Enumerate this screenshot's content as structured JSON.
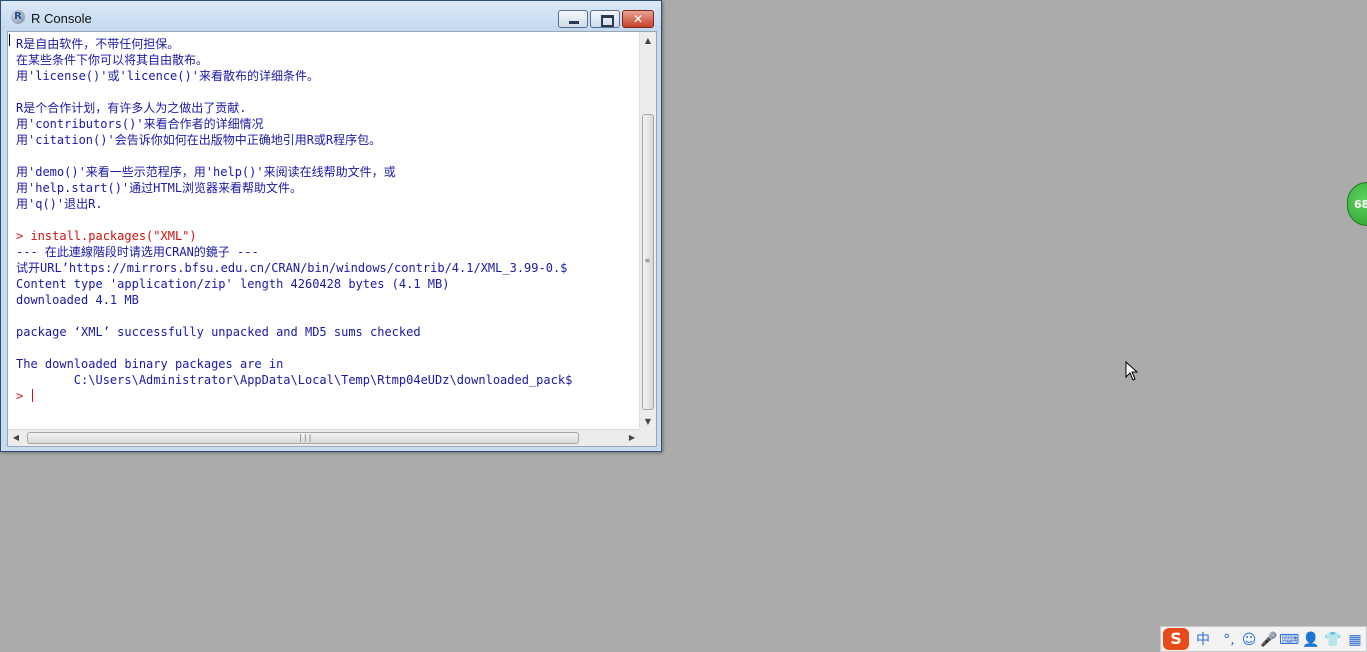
{
  "window": {
    "title": "R Console",
    "app_icon_letter": "R",
    "close_glyph": "✕"
  },
  "console": {
    "lines": [
      {
        "type": "output",
        "text": "R是自由软件，不带任何担保。"
      },
      {
        "type": "output",
        "text": "在某些条件下你可以将其自由散布。"
      },
      {
        "type": "output",
        "text": "用'license()'或'licence()'来看散布的详细条件。"
      },
      {
        "type": "output",
        "text": ""
      },
      {
        "type": "output",
        "text": "R是个合作计划，有许多人为之做出了贡献."
      },
      {
        "type": "output",
        "text": "用'contributors()'来看合作者的详细情况"
      },
      {
        "type": "output",
        "text": "用'citation()'会告诉你如何在出版物中正确地引用R或R程序包。"
      },
      {
        "type": "output",
        "text": ""
      },
      {
        "type": "output",
        "text": "用'demo()'来看一些示范程序，用'help()'来阅读在线帮助文件，或"
      },
      {
        "type": "output",
        "text": "用'help.start()'通过HTML浏览器来看帮助文件。"
      },
      {
        "type": "output",
        "text": "用'q()'退出R."
      },
      {
        "type": "output",
        "text": ""
      },
      {
        "type": "cmd",
        "text": "> install.packages(\"XML\")"
      },
      {
        "type": "output",
        "text": "--- 在此連線階段时请选用CRAN的鏡子 ---"
      },
      {
        "type": "output",
        "text": "试开URL’https://mirrors.bfsu.edu.cn/CRAN/bin/windows/contrib/4.1/XML_3.99-0.$"
      },
      {
        "type": "output",
        "text": "Content type 'application/zip' length 4260428 bytes (4.1 MB)"
      },
      {
        "type": "output",
        "text": "downloaded 4.1 MB"
      },
      {
        "type": "output",
        "text": ""
      },
      {
        "type": "output",
        "text": "package ‘XML’ successfully unpacked and MD5 sums checked"
      },
      {
        "type": "output",
        "text": ""
      },
      {
        "type": "output",
        "text": "The downloaded binary packages are in"
      },
      {
        "type": "output",
        "text": "        C:\\Users\\Administrator\\AppData\\Local\\Temp\\Rtmp04eUDz\\downloaded_pack$"
      }
    ],
    "prompt": ">"
  },
  "badge": {
    "text": "68"
  },
  "ime": {
    "logo": "S",
    "items": [
      {
        "name": "chinese-mode",
        "text": "中"
      },
      {
        "name": "punctuation",
        "text": "°,"
      },
      {
        "name": "emoji-icon",
        "text": "☺"
      },
      {
        "name": "microphone-icon",
        "text": "🎤"
      },
      {
        "name": "keyboard-icon",
        "text": "⌨"
      },
      {
        "name": "user-icon",
        "text": "👤"
      },
      {
        "name": "skin-icon",
        "text": "👕"
      },
      {
        "name": "toolbox-icon",
        "text": "▦"
      }
    ]
  },
  "colors": {
    "output_text": "#1a1aa8",
    "command_text": "#d01010",
    "desktop": "#ababab"
  }
}
